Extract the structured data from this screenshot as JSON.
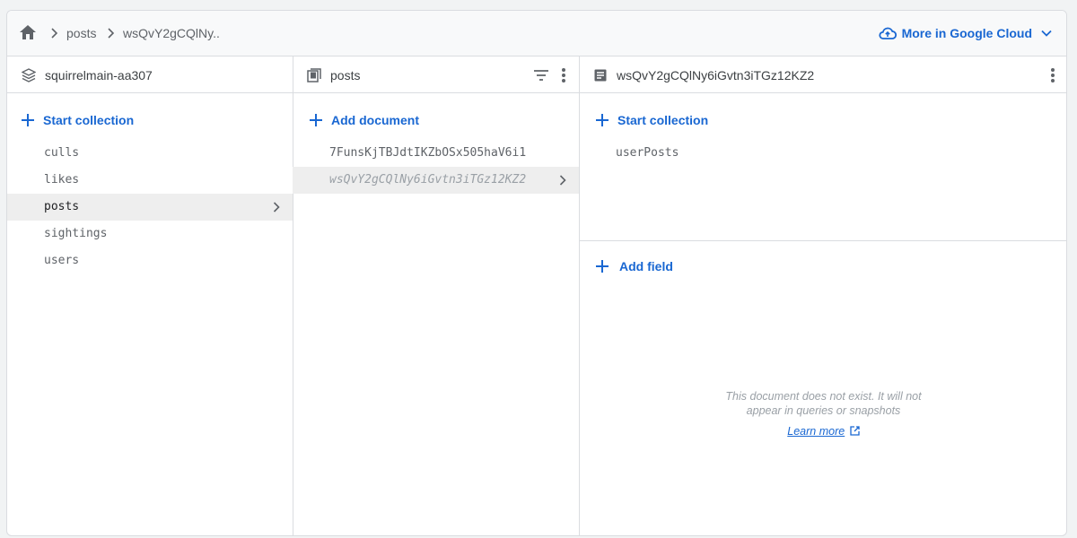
{
  "breadcrumb": {
    "items": [
      "posts",
      "wsQvY2gCQlNy.."
    ]
  },
  "header": {
    "cloud_label": "More in Google Cloud"
  },
  "root_panel": {
    "title": "squirrelmain-aa307",
    "action": "Start collection",
    "collections": [
      "culls",
      "likes",
      "posts",
      "sightings",
      "users"
    ],
    "selected": "posts"
  },
  "collection_panel": {
    "title": "posts",
    "action": "Add document",
    "documents": [
      "7FunsKjTBJdtIKZbOSx505haV6i1",
      "wsQvY2gCQlNy6iGvtn3iTGz12KZ2"
    ],
    "selected": "wsQvY2gCQlNy6iGvtn3iTGz12KZ2"
  },
  "document_panel": {
    "title": "wsQvY2gCQlNy6iGvtn3iTGz12KZ2",
    "action_collection": "Start collection",
    "subcollections": [
      "userPosts"
    ],
    "action_field": "Add field",
    "message_line1": "This document does not exist. It will not",
    "message_line2": "appear in queries or snapshots",
    "learn_more": "Learn more"
  },
  "colors": {
    "accent": "#1967d2",
    "border": "#dadce0",
    "selected_row": "#eeeeee"
  }
}
